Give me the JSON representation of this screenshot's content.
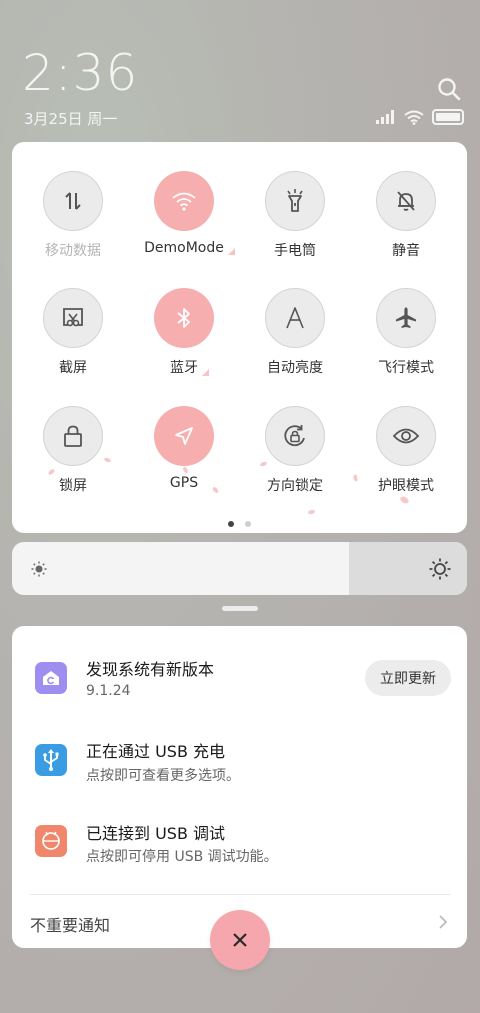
{
  "status": {
    "time": "2:36",
    "date": "3月25日 周一"
  },
  "quick_settings": {
    "tiles": [
      {
        "label": "移动数据",
        "icon": "mobile-data-icon",
        "state": "disabled"
      },
      {
        "label": "DemoMode",
        "icon": "wifi-icon",
        "state": "on"
      },
      {
        "label": "手电筒",
        "icon": "flashlight-icon",
        "state": "off"
      },
      {
        "label": "静音",
        "icon": "mute-bell-icon",
        "state": "off"
      },
      {
        "label": "截屏",
        "icon": "screenshot-icon",
        "state": "off"
      },
      {
        "label": "蓝牙",
        "icon": "bluetooth-icon",
        "state": "on"
      },
      {
        "label": "自动亮度",
        "icon": "auto-brightness-icon",
        "state": "off"
      },
      {
        "label": "飞行模式",
        "icon": "airplane-icon",
        "state": "off"
      },
      {
        "label": "锁屏",
        "icon": "lock-icon",
        "state": "off"
      },
      {
        "label": "GPS",
        "icon": "gps-icon",
        "state": "on"
      },
      {
        "label": "方向锁定",
        "icon": "rotation-lock-icon",
        "state": "off"
      },
      {
        "label": "护眼模式",
        "icon": "eye-icon",
        "state": "off"
      }
    ],
    "page_count": 2,
    "current_page": 1
  },
  "brightness": {
    "level": 0.74
  },
  "notifications": {
    "items": [
      {
        "title": "发现系统有新版本",
        "subtitle": "9.1.24",
        "icon": "update-icon",
        "action": "立即更新"
      },
      {
        "title": "正在通过 USB 充电",
        "subtitle": "点按即可查看更多选项。",
        "icon": "usb-icon"
      },
      {
        "title": "已连接到 USB 调试",
        "subtitle": "点按即可停用 USB 调试功能。",
        "icon": "android-debug-icon"
      }
    ],
    "minor_label": "不重要通知"
  },
  "colors": {
    "accent_pink": "#f7aeae",
    "update_icon_bg": "#9d8ef0",
    "usb_icon_bg": "#3a9de3",
    "debug_icon_bg": "#f0876d"
  }
}
